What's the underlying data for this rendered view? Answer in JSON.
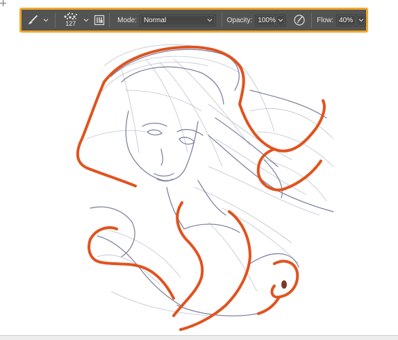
{
  "toolbar": {
    "brush_tool_icon": "brush-icon",
    "brush_size": "127",
    "brush_preset_icon": "brush-tip-icon",
    "brush_panel_icon": "brush-settings-panel-icon",
    "mode_label": "Mode:",
    "mode_value": "Normal",
    "opacity_label": "Opacity:",
    "opacity_value": "100%",
    "pressure_icon": "pressure-opacity-icon",
    "flow_label": "Flow:",
    "flow_value": "40%",
    "highlight_color": "#f0a72b",
    "bar_color": "#535353"
  },
  "canvas": {
    "background": "#ffffff",
    "line_color": "#8a8fa8",
    "ink_color": "#e0531f"
  }
}
